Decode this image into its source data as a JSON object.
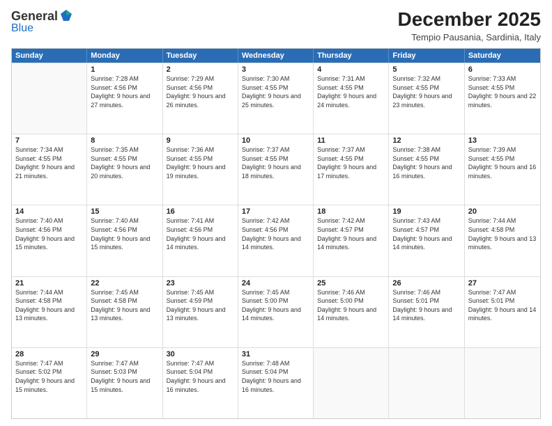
{
  "logo": {
    "general": "General",
    "blue": "Blue"
  },
  "header": {
    "month": "December 2025",
    "location": "Tempio Pausania, Sardinia, Italy"
  },
  "weekdays": [
    "Sunday",
    "Monday",
    "Tuesday",
    "Wednesday",
    "Thursday",
    "Friday",
    "Saturday"
  ],
  "weeks": [
    [
      {
        "day": "",
        "sunrise": "",
        "sunset": "",
        "daylight": ""
      },
      {
        "day": "1",
        "sunrise": "Sunrise: 7:28 AM",
        "sunset": "Sunset: 4:56 PM",
        "daylight": "Daylight: 9 hours and 27 minutes."
      },
      {
        "day": "2",
        "sunrise": "Sunrise: 7:29 AM",
        "sunset": "Sunset: 4:56 PM",
        "daylight": "Daylight: 9 hours and 26 minutes."
      },
      {
        "day": "3",
        "sunrise": "Sunrise: 7:30 AM",
        "sunset": "Sunset: 4:55 PM",
        "daylight": "Daylight: 9 hours and 25 minutes."
      },
      {
        "day": "4",
        "sunrise": "Sunrise: 7:31 AM",
        "sunset": "Sunset: 4:55 PM",
        "daylight": "Daylight: 9 hours and 24 minutes."
      },
      {
        "day": "5",
        "sunrise": "Sunrise: 7:32 AM",
        "sunset": "Sunset: 4:55 PM",
        "daylight": "Daylight: 9 hours and 23 minutes."
      },
      {
        "day": "6",
        "sunrise": "Sunrise: 7:33 AM",
        "sunset": "Sunset: 4:55 PM",
        "daylight": "Daylight: 9 hours and 22 minutes."
      }
    ],
    [
      {
        "day": "7",
        "sunrise": "Sunrise: 7:34 AM",
        "sunset": "Sunset: 4:55 PM",
        "daylight": "Daylight: 9 hours and 21 minutes."
      },
      {
        "day": "8",
        "sunrise": "Sunrise: 7:35 AM",
        "sunset": "Sunset: 4:55 PM",
        "daylight": "Daylight: 9 hours and 20 minutes."
      },
      {
        "day": "9",
        "sunrise": "Sunrise: 7:36 AM",
        "sunset": "Sunset: 4:55 PM",
        "daylight": "Daylight: 9 hours and 19 minutes."
      },
      {
        "day": "10",
        "sunrise": "Sunrise: 7:37 AM",
        "sunset": "Sunset: 4:55 PM",
        "daylight": "Daylight: 9 hours and 18 minutes."
      },
      {
        "day": "11",
        "sunrise": "Sunrise: 7:37 AM",
        "sunset": "Sunset: 4:55 PM",
        "daylight": "Daylight: 9 hours and 17 minutes."
      },
      {
        "day": "12",
        "sunrise": "Sunrise: 7:38 AM",
        "sunset": "Sunset: 4:55 PM",
        "daylight": "Daylight: 9 hours and 16 minutes."
      },
      {
        "day": "13",
        "sunrise": "Sunrise: 7:39 AM",
        "sunset": "Sunset: 4:55 PM",
        "daylight": "Daylight: 9 hours and 16 minutes."
      }
    ],
    [
      {
        "day": "14",
        "sunrise": "Sunrise: 7:40 AM",
        "sunset": "Sunset: 4:56 PM",
        "daylight": "Daylight: 9 hours and 15 minutes."
      },
      {
        "day": "15",
        "sunrise": "Sunrise: 7:40 AM",
        "sunset": "Sunset: 4:56 PM",
        "daylight": "Daylight: 9 hours and 15 minutes."
      },
      {
        "day": "16",
        "sunrise": "Sunrise: 7:41 AM",
        "sunset": "Sunset: 4:56 PM",
        "daylight": "Daylight: 9 hours and 14 minutes."
      },
      {
        "day": "17",
        "sunrise": "Sunrise: 7:42 AM",
        "sunset": "Sunset: 4:56 PM",
        "daylight": "Daylight: 9 hours and 14 minutes."
      },
      {
        "day": "18",
        "sunrise": "Sunrise: 7:42 AM",
        "sunset": "Sunset: 4:57 PM",
        "daylight": "Daylight: 9 hours and 14 minutes."
      },
      {
        "day": "19",
        "sunrise": "Sunrise: 7:43 AM",
        "sunset": "Sunset: 4:57 PM",
        "daylight": "Daylight: 9 hours and 14 minutes."
      },
      {
        "day": "20",
        "sunrise": "Sunrise: 7:44 AM",
        "sunset": "Sunset: 4:58 PM",
        "daylight": "Daylight: 9 hours and 13 minutes."
      }
    ],
    [
      {
        "day": "21",
        "sunrise": "Sunrise: 7:44 AM",
        "sunset": "Sunset: 4:58 PM",
        "daylight": "Daylight: 9 hours and 13 minutes."
      },
      {
        "day": "22",
        "sunrise": "Sunrise: 7:45 AM",
        "sunset": "Sunset: 4:58 PM",
        "daylight": "Daylight: 9 hours and 13 minutes."
      },
      {
        "day": "23",
        "sunrise": "Sunrise: 7:45 AM",
        "sunset": "Sunset: 4:59 PM",
        "daylight": "Daylight: 9 hours and 13 minutes."
      },
      {
        "day": "24",
        "sunrise": "Sunrise: 7:45 AM",
        "sunset": "Sunset: 5:00 PM",
        "daylight": "Daylight: 9 hours and 14 minutes."
      },
      {
        "day": "25",
        "sunrise": "Sunrise: 7:46 AM",
        "sunset": "Sunset: 5:00 PM",
        "daylight": "Daylight: 9 hours and 14 minutes."
      },
      {
        "day": "26",
        "sunrise": "Sunrise: 7:46 AM",
        "sunset": "Sunset: 5:01 PM",
        "daylight": "Daylight: 9 hours and 14 minutes."
      },
      {
        "day": "27",
        "sunrise": "Sunrise: 7:47 AM",
        "sunset": "Sunset: 5:01 PM",
        "daylight": "Daylight: 9 hours and 14 minutes."
      }
    ],
    [
      {
        "day": "28",
        "sunrise": "Sunrise: 7:47 AM",
        "sunset": "Sunset: 5:02 PM",
        "daylight": "Daylight: 9 hours and 15 minutes."
      },
      {
        "day": "29",
        "sunrise": "Sunrise: 7:47 AM",
        "sunset": "Sunset: 5:03 PM",
        "daylight": "Daylight: 9 hours and 15 minutes."
      },
      {
        "day": "30",
        "sunrise": "Sunrise: 7:47 AM",
        "sunset": "Sunset: 5:04 PM",
        "daylight": "Daylight: 9 hours and 16 minutes."
      },
      {
        "day": "31",
        "sunrise": "Sunrise: 7:48 AM",
        "sunset": "Sunset: 5:04 PM",
        "daylight": "Daylight: 9 hours and 16 minutes."
      },
      {
        "day": "",
        "sunrise": "",
        "sunset": "",
        "daylight": ""
      },
      {
        "day": "",
        "sunrise": "",
        "sunset": "",
        "daylight": ""
      },
      {
        "day": "",
        "sunrise": "",
        "sunset": "",
        "daylight": ""
      }
    ]
  ]
}
